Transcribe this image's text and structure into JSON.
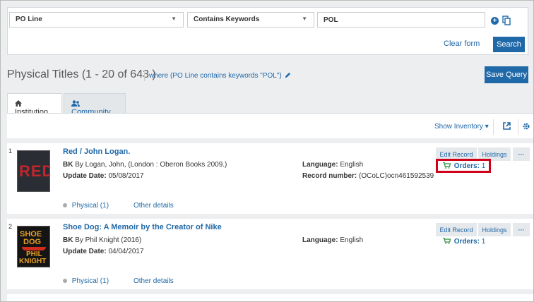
{
  "search": {
    "field": "PO Line",
    "operator": "Contains Keywords",
    "value": "POL",
    "clear_label": "Clear form",
    "search_label": "Search"
  },
  "results": {
    "title": "Physical Titles (1 - 20 of 643 )",
    "where": "where (PO Line contains keywords \"POL\")",
    "save_query_label": "Save Query"
  },
  "tabs": [
    {
      "label": "Institution"
    },
    {
      "label": "Community"
    }
  ],
  "toolbar": {
    "show_inventory_label": "Show Inventory"
  },
  "items": [
    {
      "index": "1",
      "cover_text": "RED",
      "title": "Red / John Logan.",
      "type": "BK",
      "byline": "By Logan, John, (London : Oberon Books 2009.)",
      "update_label": "Update Date:",
      "update_date": "05/08/2017",
      "language_label": "Language:",
      "language": "English",
      "record_label": "Record number:",
      "record_number": "(OCoLC)ocn461592539",
      "edit_label": "Edit Record",
      "holdings_label": "Holdings",
      "more_label": "···",
      "orders_label": "Orders:",
      "orders_count": "1",
      "physical_label": "Physical (1)",
      "other_label": "Other details"
    },
    {
      "index": "2",
      "cover_text_1": "SHOE",
      "cover_text_2": "DOG",
      "cover_text_3": "PHIL",
      "cover_text_4": "KNIGHT",
      "title": "Shoe Dog: A Memoir by the Creator of Nike",
      "type": "BK",
      "byline": "By Phil Knight (2016)",
      "update_label": "Update Date:",
      "update_date": "04/04/2017",
      "language_label": "Language:",
      "language": "English",
      "edit_label": "Edit Record",
      "holdings_label": "Holdings",
      "more_label": "···",
      "orders_label": "Orders:",
      "orders_count": "1",
      "physical_label": "Physical (1)",
      "other_label": "Other details"
    }
  ],
  "colors": {
    "brand": "#2069a8",
    "highlight": "#d0021b"
  }
}
